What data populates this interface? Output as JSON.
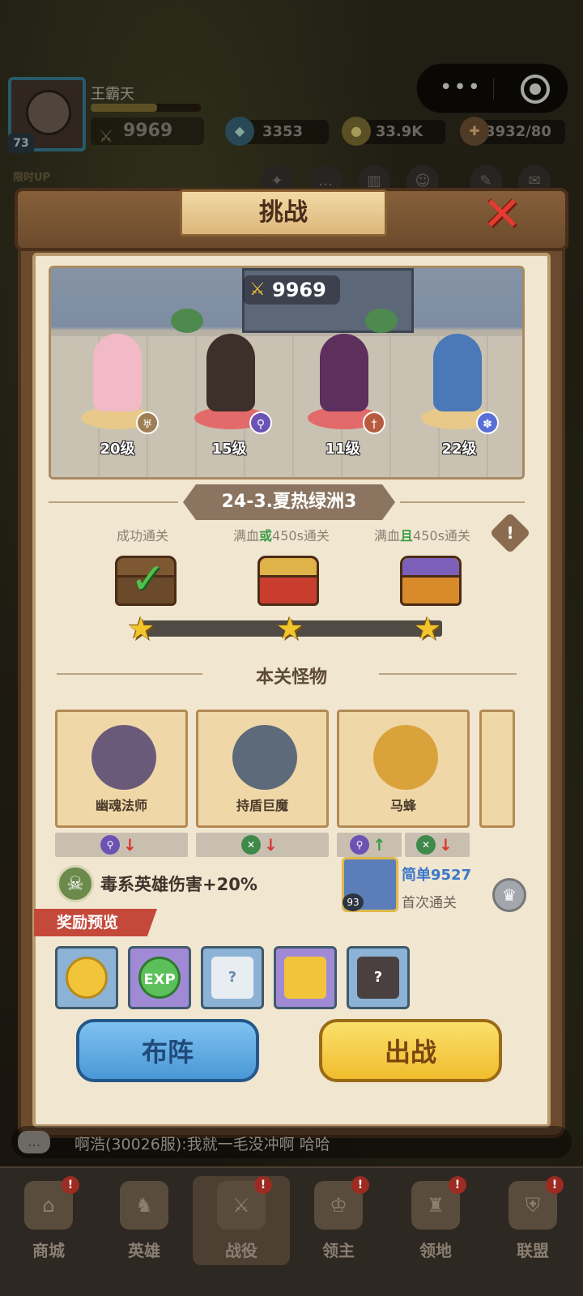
{
  "player": {
    "name": "王霸天",
    "level": "73",
    "power": "9969",
    "gems": "3353",
    "gold": "33.9K",
    "stamina": "3932/80",
    "limited_tag": "限时UP"
  },
  "dialog": {
    "title": "挑战",
    "team_power": "9969",
    "heroes": [
      {
        "level": "20级",
        "class_icon": "wing-icon"
      },
      {
        "level": "15级",
        "class_icon": "staff-icon"
      },
      {
        "level": "11级",
        "class_icon": "sword-icon"
      },
      {
        "level": "22级",
        "class_icon": "paw-icon"
      }
    ],
    "stage_name": "24-3.夏热绿洲3",
    "conditions": {
      "c1": "成功通关",
      "c2_pre": "满血",
      "c2_or": "或",
      "c2_post": "450s通关",
      "c3_pre": "满血",
      "c3_and": "且",
      "c3_post": "450s通关"
    },
    "stars_earned": 1,
    "monsters_title": "本关怪物",
    "monsters": [
      {
        "name": "幽魂法师"
      },
      {
        "name": "持盾巨魔"
      },
      {
        "name": "马蜂"
      }
    ],
    "buff_text": "毒系英雄伤害+20%",
    "first_clear": {
      "player": "简单9527",
      "label": "首次通关",
      "level": "93"
    },
    "reward_title": "奖励预览",
    "rewards": [
      {
        "icon": "gold-coin-icon",
        "label": ""
      },
      {
        "icon": "exp-icon",
        "label": "EXP"
      },
      {
        "icon": "mystery-scroll-icon",
        "label": "?"
      },
      {
        "icon": "ticket-icon",
        "label": ""
      },
      {
        "icon": "mystery-armor-icon",
        "label": "?"
      }
    ],
    "formation_btn": "布阵",
    "battle_btn": "出战"
  },
  "chat": {
    "text": "啊浩(30026服):我就一毛没冲啊 哈哈"
  },
  "nav": [
    {
      "label": "商城",
      "badge": "!"
    },
    {
      "label": "英雄",
      "badge": ""
    },
    {
      "label": "战役",
      "badge": "!"
    },
    {
      "label": "领主",
      "badge": "!"
    },
    {
      "label": "领地",
      "badge": "!"
    },
    {
      "label": "联盟",
      "badge": "!"
    }
  ]
}
